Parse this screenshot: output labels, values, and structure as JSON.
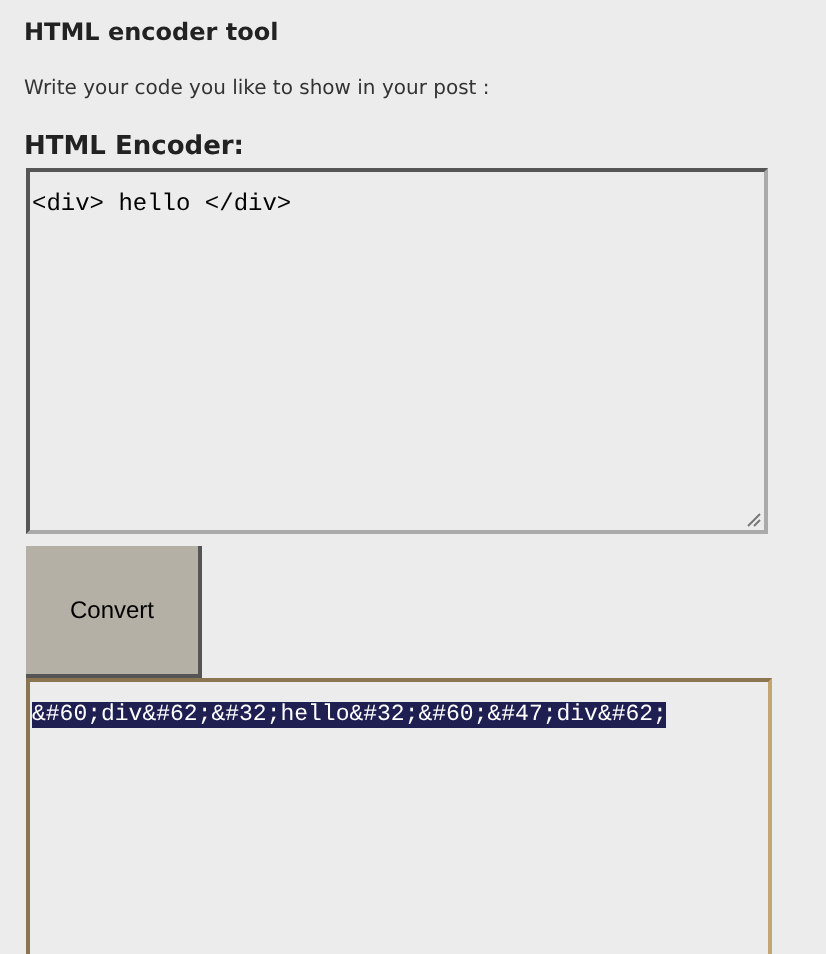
{
  "title": "HTML encoder tool",
  "instructions": "Write your code you like to show in your post :",
  "encoder": {
    "label": "HTML Encoder:",
    "value": "<div> hello </div>"
  },
  "convert_button": "Convert",
  "output": {
    "value": "&#60;div&#62;&#32;hello&#32;&#60;&#47;div&#62;",
    "selected": true
  }
}
